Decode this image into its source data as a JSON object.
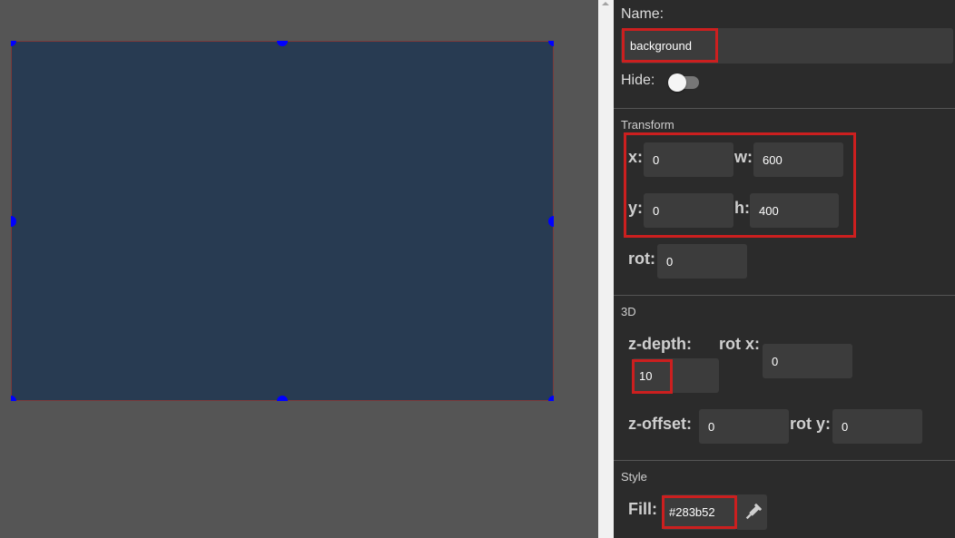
{
  "canvas": {
    "shape_fill": "#283b52",
    "handle_color": "#0000ff"
  },
  "panel": {
    "name_label": "Name:",
    "name_value": "background",
    "hide_label": "Hide:",
    "hide_on": false,
    "transform": {
      "title": "Transform",
      "x_label": "x:",
      "x_value": "0",
      "w_label": "w:",
      "w_value": "600",
      "y_label": "y:",
      "y_value": "0",
      "h_label": "h:",
      "h_value": "400",
      "rot_label": "rot:",
      "rot_value": "0"
    },
    "three_d": {
      "title": "3D",
      "zdepth_label": "z-depth:",
      "zdepth_value": "10",
      "rotx_label": "rot x:",
      "rotx_value": "0",
      "zoffset_label": "z-offset:",
      "zoffset_value": "0",
      "roty_label": "rot y:",
      "roty_value": "0"
    },
    "style": {
      "title": "Style",
      "fill_label": "Fill:",
      "fill_value": "#283b52",
      "eyedropper_icon": "eyedropper-icon"
    }
  },
  "colors": {
    "panel_bg": "#2b2b2b",
    "input_bg": "#3c3c3c",
    "highlight": "#cc1f1f"
  }
}
